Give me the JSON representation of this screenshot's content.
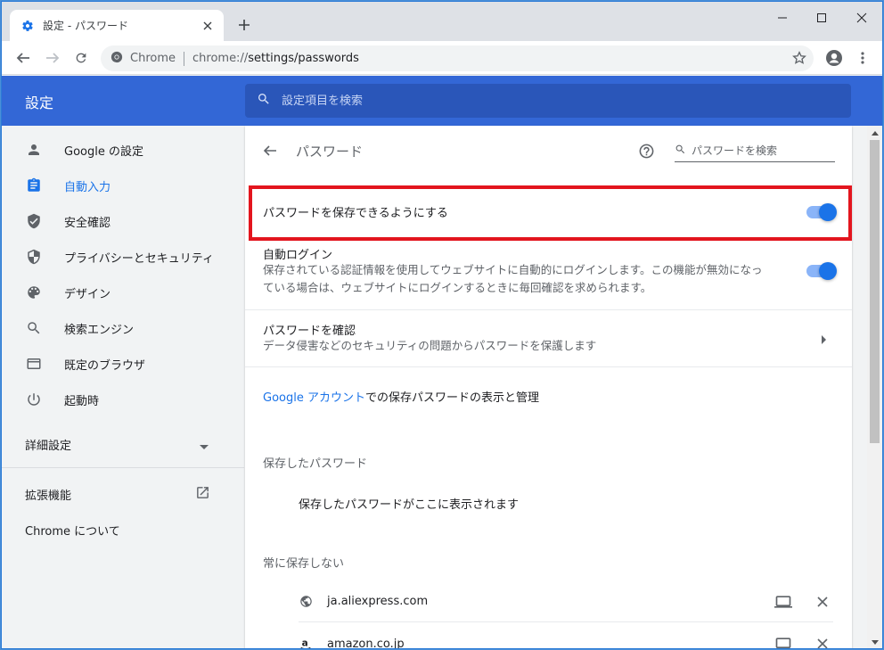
{
  "tab": {
    "title": "設定 - パスワード"
  },
  "toolbar": {
    "site_label": "Chrome",
    "url_scheme": "chrome://",
    "url_path": "settings/passwords"
  },
  "header": {
    "title": "設定",
    "search_placeholder": "設定項目を検索"
  },
  "sidebar": {
    "items": [
      {
        "label": "Google の設定",
        "icon": "person-icon"
      },
      {
        "label": "自動入力",
        "icon": "clipboard-icon",
        "active": true
      },
      {
        "label": "安全確認",
        "icon": "shield-check-icon"
      },
      {
        "label": "プライバシーとセキュリティ",
        "icon": "shield-half-icon"
      },
      {
        "label": "デザイン",
        "icon": "palette-icon"
      },
      {
        "label": "検索エンジン",
        "icon": "search-icon"
      },
      {
        "label": "既定のブラウザ",
        "icon": "browser-window-icon"
      },
      {
        "label": "起動時",
        "icon": "power-icon"
      }
    ],
    "advanced": "詳細設定",
    "extensions": "拡張機能",
    "about": "Chrome について"
  },
  "page": {
    "title": "パスワード",
    "search_placeholder": "パスワードを検索",
    "offer_to_save": {
      "label": "パスワードを保存できるようにする",
      "enabled": true
    },
    "auto_signin": {
      "label": "自動ログイン",
      "desc_line1": "保存されている認証情報を使用してウェブサイトに自動的にログインします。この機能が無効になっ",
      "desc_line2": "ている場合は、ウェブサイトにログインするときに毎回確認を求められます。",
      "enabled": true
    },
    "check_passwords": {
      "label": "パスワードを確認",
      "desc": "データ侵害などのセキュリティの問題からパスワードを保護します"
    },
    "google_account": {
      "link": "Google アカウント",
      "rest": "での保存パスワードの表示と管理"
    },
    "saved_header": "保存したパスワード",
    "saved_empty": "保存したパスワードがここに表示されます",
    "never_header": "常に保存しない",
    "never_sites": [
      {
        "name": "ja.aliexpress.com",
        "icon": "globe-icon"
      },
      {
        "name": "amazon.co.jp",
        "icon": "amazon-icon"
      }
    ]
  },
  "colors": {
    "accent": "#1a73e8",
    "header": "#3367d6",
    "highlight": "#e3151e"
  }
}
